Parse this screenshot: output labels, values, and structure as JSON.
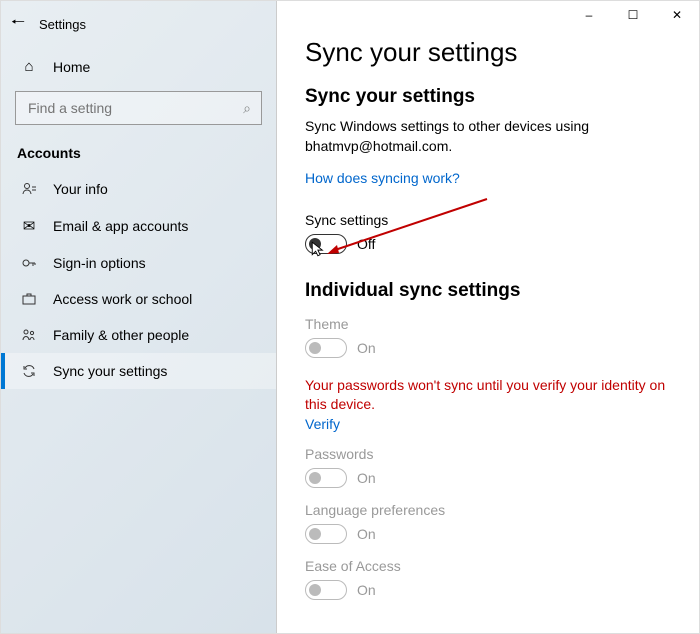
{
  "window": {
    "title": "Settings",
    "minimize": "–",
    "maximize": "☐",
    "close": "✕"
  },
  "sidebar": {
    "home": "Home",
    "search_placeholder": "Find a setting",
    "section": "Accounts",
    "items": [
      {
        "icon": "user",
        "label": "Your info"
      },
      {
        "icon": "mail",
        "label": "Email & app accounts"
      },
      {
        "icon": "key",
        "label": "Sign-in options"
      },
      {
        "icon": "briefcase",
        "label": "Access work or school"
      },
      {
        "icon": "people",
        "label": "Family & other people"
      },
      {
        "icon": "sync",
        "label": "Sync your settings",
        "selected": true
      }
    ]
  },
  "main": {
    "page_title": "Sync your settings",
    "section_title": "Sync your settings",
    "desc_line1": "Sync Windows settings to other devices using",
    "desc_line2": "bhatmvp@hotmail.com.",
    "help_link": "How does syncing work?",
    "main_toggle": {
      "label": "Sync settings",
      "state": "Off"
    },
    "individual_title": "Individual sync settings",
    "items": [
      {
        "label": "Theme",
        "state": "On",
        "disabled": true
      }
    ],
    "warning": "Your passwords won't sync until you verify your identity on this device.",
    "verify": "Verify",
    "items2": [
      {
        "label": "Passwords",
        "state": "On",
        "disabled": true
      },
      {
        "label": "Language preferences",
        "state": "On",
        "disabled": true
      },
      {
        "label": "Ease of Access",
        "state": "On",
        "disabled": true
      }
    ]
  }
}
